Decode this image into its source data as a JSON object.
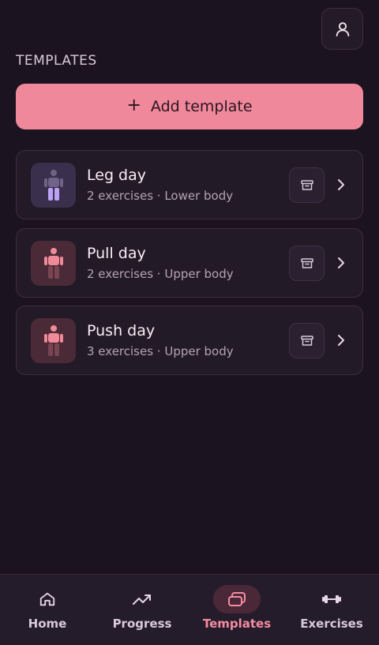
{
  "header": {
    "section_title": "TEMPLATES"
  },
  "add_button": {
    "label": "Add template",
    "plus": "+"
  },
  "templates": [
    {
      "name": "Leg day",
      "meta": "2 exercises · Lower body",
      "body_part": "lower"
    },
    {
      "name": "Pull day",
      "meta": "2 exercises · Upper body",
      "body_part": "upper"
    },
    {
      "name": "Push day",
      "meta": "3 exercises · Upper body",
      "body_part": "upper"
    }
  ],
  "nav": {
    "items": [
      {
        "label": "Home",
        "icon": "home-icon"
      },
      {
        "label": "Progress",
        "icon": "trending-up-icon"
      },
      {
        "label": "Templates",
        "icon": "templates-icon",
        "active": true
      },
      {
        "label": "Exercises",
        "icon": "dumbbell-icon"
      }
    ]
  },
  "colors": {
    "background": "#1b1420",
    "accent": "#f0889b",
    "lower_body_highlight": "#b9a3f5",
    "upper_body_highlight": "#f08a98"
  }
}
